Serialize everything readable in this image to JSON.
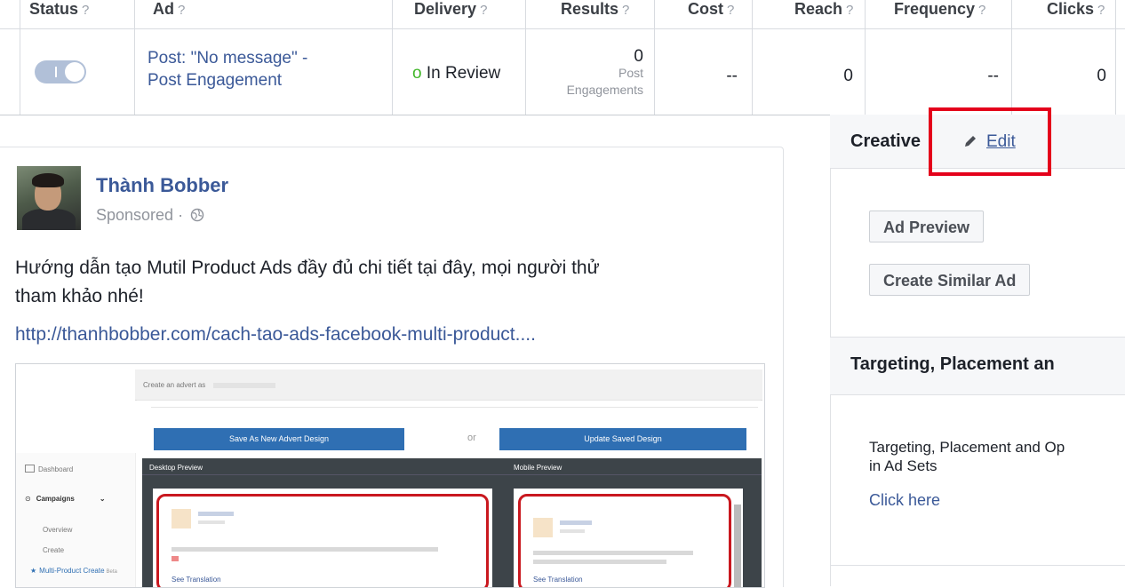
{
  "table": {
    "headers": {
      "status": "Status",
      "ad": "Ad",
      "delivery": "Delivery",
      "results": "Results",
      "cost": "Cost",
      "reach": "Reach",
      "frequency": "Frequency",
      "clicks": "Clicks",
      "help_mark": "?"
    },
    "row": {
      "ad_name_line1": "Post: \"No message\" -",
      "ad_name_line2": "Post Engagement",
      "delivery_dot": "o",
      "delivery_status": "In Review",
      "results_value": "0",
      "results_label_line1": "Post",
      "results_label_line2": "Engagements",
      "cost": "--",
      "reach": "0",
      "frequency": "--",
      "clicks": "0"
    }
  },
  "post": {
    "author": "Thành Bobber",
    "sponsored": "Sponsored ·",
    "text_line1": "Hướng dẫn tạo Mutil Product Ads đầy đủ chi tiết tại đây, mọi người thử",
    "text_line2": "tham khảo nhé!",
    "link": "http://thanhbobber.com/cach-tao-ads-facebook-multi-product...."
  },
  "thumbnail": {
    "create_as": "Create an advert as",
    "save_new": "Save As New Advert Design",
    "or": "or",
    "update_saved": "Update Saved Design",
    "desktop_preview": "Desktop Preview",
    "mobile_preview": "Mobile Preview",
    "nav_dashboard": "Dashboard",
    "nav_campaigns": "Campaigns",
    "nav_overview": "Overview",
    "nav_create": "Create",
    "nav_multi": "Multi-Product Create",
    "nav_beta": "Beta",
    "see_translation_1": "See Translation",
    "see_translation_2": "See Translation"
  },
  "right": {
    "creative_title": "Creative",
    "edit_link": "Edit",
    "ad_preview": "Ad Preview",
    "create_similar": "Create Similar Ad",
    "targeting_title": "Targeting, Placement an",
    "targeting_text_line1": "Targeting, Placement and Op",
    "targeting_text_line2": "in Ad Sets",
    "click_here": "Click here"
  },
  "colors": {
    "link": "#3b5998",
    "highlight_box": "#e4001b",
    "delivery_dot": "#42b72a",
    "toggle": "#b1c0d8"
  }
}
